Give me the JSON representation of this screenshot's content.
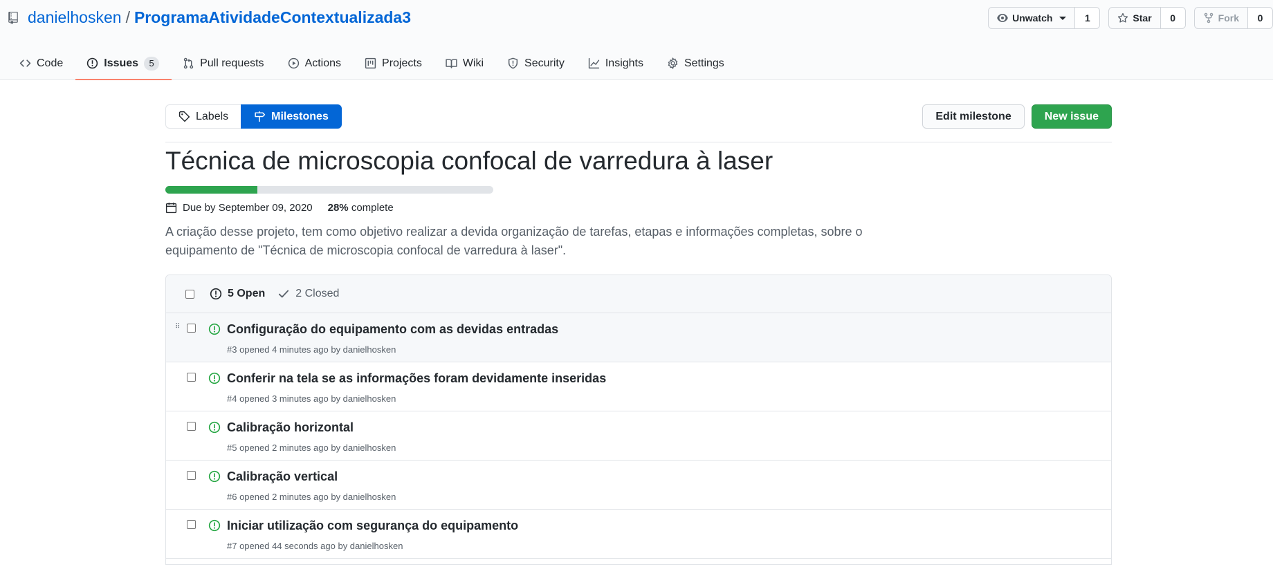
{
  "repo": {
    "owner": "danielhosken",
    "separator": "/",
    "name": "ProgramaAtividadeContextualizada3"
  },
  "actions": {
    "watch_label": "Unwatch",
    "watch_count": "1",
    "star_label": "Star",
    "star_count": "0",
    "fork_label": "Fork",
    "fork_count": "0"
  },
  "nav": {
    "code": "Code",
    "issues": "Issues",
    "issues_count": "5",
    "pulls": "Pull requests",
    "actions": "Actions",
    "projects": "Projects",
    "wiki": "Wiki",
    "security": "Security",
    "insights": "Insights",
    "settings": "Settings"
  },
  "subnav": {
    "labels": "Labels",
    "milestones": "Milestones"
  },
  "buttons": {
    "edit_milestone": "Edit milestone",
    "new_issue": "New issue"
  },
  "milestone": {
    "title": "Técnica de microscopia confocal de varredura à laser",
    "progress_fraction": 0.28,
    "due": "Due by September 09, 2020",
    "percent": "28%",
    "complete_label": "complete",
    "description": "A criação desse projeto, tem como objetivo realizar a devida organização de tarefas, etapas e informações completas, sobre o equipamento de \"Técnica de microscopia confocal de varredura à laser\"."
  },
  "issues_box": {
    "open_label": "5 Open",
    "closed_label": "2 Closed"
  },
  "issues": [
    {
      "title": "Configuração do equipamento com as devidas entradas",
      "meta": "#3 opened 4 minutes ago by danielhosken"
    },
    {
      "title": "Conferir na tela se as informações foram devidamente inseridas",
      "meta": "#4 opened 3 minutes ago by danielhosken"
    },
    {
      "title": "Calibração horizontal",
      "meta": "#5 opened 2 minutes ago by danielhosken"
    },
    {
      "title": "Calibração vertical",
      "meta": "#6 opened 2 minutes ago by danielhosken"
    },
    {
      "title": "Iniciar utilização com segurança do equipamento",
      "meta": "#7 opened 44 seconds ago by danielhosken"
    }
  ],
  "colors": {
    "link": "#0366d6",
    "open_icon": "#28a745",
    "progress_fill": "#2ea44f",
    "primary_button": "#2ea44f",
    "active_tab_underline": "#f9826c"
  }
}
